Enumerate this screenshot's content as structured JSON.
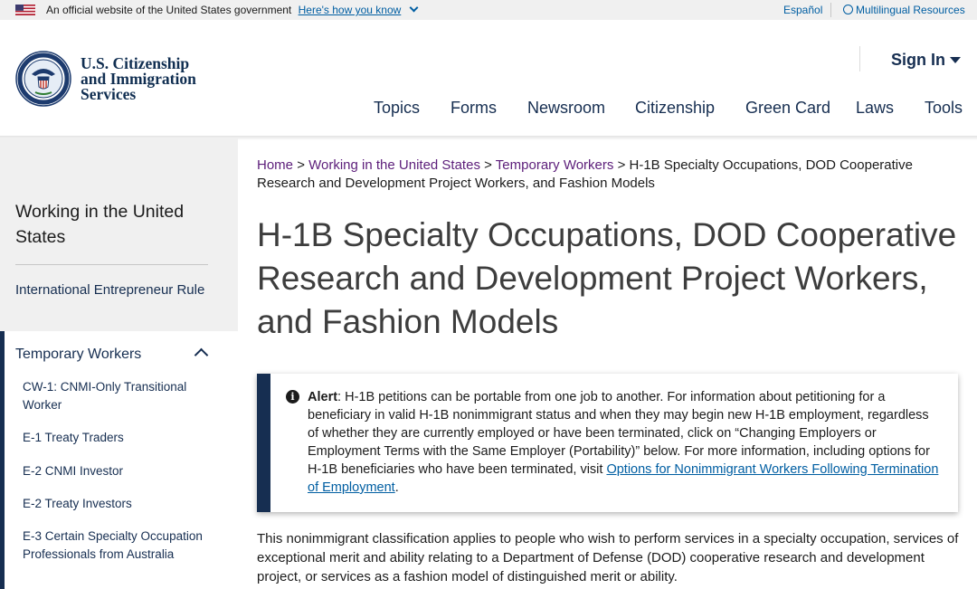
{
  "gov_banner": {
    "text": "An official website of the United States government",
    "link": "Here's how you know",
    "espanol": "Español",
    "multilingual": "Multilingual Resources"
  },
  "header": {
    "agency_line1": "U.S. Citizenship",
    "agency_line2": "and Immigration",
    "agency_line3": "Services",
    "sign_in": "Sign In",
    "nav": [
      "Topics",
      "Forms",
      "Newsroom",
      "Citizenship",
      "Green Card",
      "Laws",
      "Tools"
    ]
  },
  "sidebar": {
    "title": "Working in the United States",
    "item_ie": "International Entrepreneur Rule",
    "active": "Temporary Workers",
    "sub_items": [
      "CW-1: CNMI-Only Transitional Worker",
      "E-1 Treaty Traders",
      "E-2 CNMI Investor",
      "E-2 Treaty Investors",
      "E-3 Certain Specialty Occupation Professionals from Australia"
    ]
  },
  "breadcrumb": {
    "items": [
      "Home",
      "Working in the United States",
      "Temporary Workers"
    ],
    "separator": ">",
    "current": "H-1B Specialty Occupations, DOD Cooperative Research and Development Project Workers, and Fashion Models"
  },
  "main": {
    "title": "H-1B Specialty Occupations, DOD Cooperative Research and Development Project Workers, and Fashion Models",
    "alert_label": "Alert",
    "alert_text": ": H-1B petitions can be portable from one job to another. For information about petitioning for a beneficiary in valid H-1B nonimmigrant status and when they may begin new H-1B employment, regardless of whether they are currently employed or have been terminated, click on “Changing Employers or Employment Terms with the Same Employer (Portability)” below. For more information, including options for H-1B beneficiaries who have been terminated, visit ",
    "alert_link": "Options for Nonimmigrant Workers Following Termination of Employment",
    "alert_end": ".",
    "body": "This nonimmigrant classification applies to people who wish to perform services in a specialty occupation, services of exceptional merit and ability relating to a Department of Defense (DOD) cooperative research and development project, or services as a fashion model of distinguished merit or ability."
  },
  "icons": {
    "alert": "i"
  },
  "colors": {
    "navy": "#162e51",
    "link_blue": "#005ea2",
    "visited_purple": "#5c1e7a",
    "sidebar_bg": "#f0f0f0"
  }
}
